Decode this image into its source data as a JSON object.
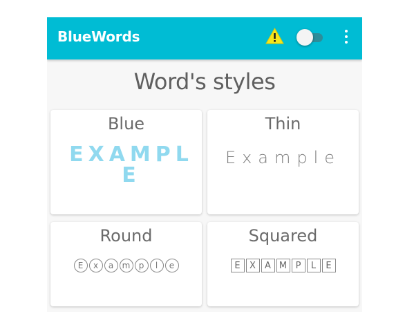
{
  "app": {
    "title": "BlueWords",
    "bar_color": "#00bcd4"
  },
  "toolbar": {
    "warning_icon": "warning-icon",
    "toggle_icon": "toggle-switch",
    "toggle_state": "off",
    "menu_icon": "more-vertical-icon"
  },
  "main": {
    "title": "Word's styles",
    "cards": [
      {
        "label": "Blue",
        "example": "EXAMPLE",
        "accent": "#90d9ef"
      },
      {
        "label": "Thin",
        "example": "Example"
      },
      {
        "label": "Round",
        "example": "ⓔⓧⓐⓜⓟⓛⓔ",
        "letters": [
          "E",
          "x",
          "a",
          "m",
          "p",
          "l",
          "e"
        ]
      },
      {
        "label": "Squared",
        "example": "EXAMPLE",
        "letters": [
          "E",
          "X",
          "A",
          "M",
          "P",
          "L",
          "E"
        ]
      }
    ]
  }
}
